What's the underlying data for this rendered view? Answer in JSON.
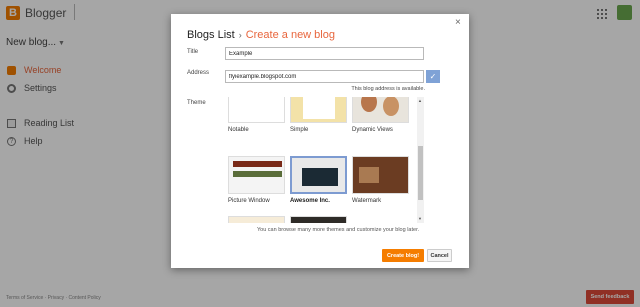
{
  "app": {
    "brand": "Blogger",
    "new_blog_label": "New blog...",
    "nav": [
      {
        "label": "Welcome",
        "active": true
      },
      {
        "label": "Settings"
      },
      {
        "label": "Reading List"
      },
      {
        "label": "Help"
      }
    ],
    "footer_links": "Terms of Service · Privacy · Content Policy",
    "feedback_label": "Send feedback"
  },
  "dialog": {
    "breadcrumb": "Blogs List",
    "separator": "›",
    "title": "Create a new blog",
    "close_glyph": "×",
    "title_label": "Title",
    "title_value": "Example",
    "address_label": "Address",
    "address_value": "flyiexample.blogspot.com",
    "address_status": "This blog address is available.",
    "check_glyph": "✓",
    "theme_label": "Theme",
    "themes": [
      {
        "name": "Notable"
      },
      {
        "name": "Simple"
      },
      {
        "name": "Dynamic Views"
      },
      {
        "name": "Picture Window"
      },
      {
        "name": "Awesome Inc.",
        "selected": true
      },
      {
        "name": "Watermark"
      },
      {
        "name": ""
      },
      {
        "name": ""
      }
    ],
    "browse_note": "You can browse many more themes and customize your blog later.",
    "create_label": "Create blog!",
    "cancel_label": "Cancel"
  },
  "colors": {
    "accent": "#e8663d",
    "brand": "#f57d00",
    "feedback": "#dd4b39",
    "selected_border": "#7d9bd1"
  }
}
